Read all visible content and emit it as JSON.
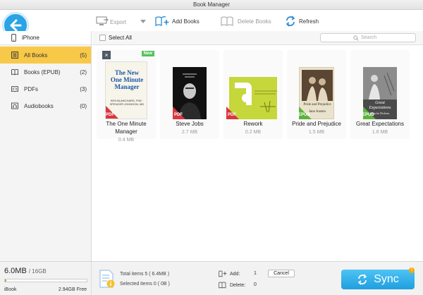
{
  "window": {
    "title": "Book Manager"
  },
  "toolbar": {
    "export_label": "Export",
    "add_label": "Add Books",
    "delete_label": "Delete Books",
    "refresh_label": "Refresh"
  },
  "sidebar": {
    "device": "iPhone",
    "items": [
      {
        "label": "All Books",
        "count": "(5)"
      },
      {
        "label": "Books (EPUB)",
        "count": "(2)"
      },
      {
        "label": "PDFs",
        "count": "(3)"
      },
      {
        "label": "Audiobooks",
        "count": "(0)"
      }
    ]
  },
  "content": {
    "select_all": "Select All",
    "search_placeholder": "Search"
  },
  "books": [
    {
      "title": "The One Minute Manager",
      "size": "0.4 MB",
      "format": "PDF",
      "tag": "New",
      "cover_text": "The New One Minute Manager",
      "cover_author": "KEN BLANCHARD, PhD · SPENCER JOHNSON, MD"
    },
    {
      "title": "Steve Jobs",
      "size": "2.7 MB",
      "format": "PDF"
    },
    {
      "title": "Rework",
      "size": "0.2 MB",
      "format": "PDF"
    },
    {
      "title": "Pride and Prejudice",
      "size": "1.5 MB",
      "format": "EPUB",
      "cover_text": "Pride and Prejudice",
      "cover_author": "Jane Austen"
    },
    {
      "title": "Great Expectations",
      "size": "1.6 MB",
      "format": "EPUB",
      "cover_text": "Great Expectations",
      "cover_author": "Charles Dickens"
    }
  ],
  "bottom": {
    "storage_used": "6.0MB",
    "storage_total": "/ 16GB",
    "storage_fraction": 0.02,
    "storage_left_label": "iBook",
    "storage_free": "2.94GB Free",
    "total_items": "Total items 5 ( 6.4MB )",
    "selected_items": "Selected items 0 ( 0B )",
    "add_label": "Add:",
    "add_value": "1",
    "delete_label": "Delete:",
    "delete_value": "0",
    "cancel_label": "Cancel",
    "sync_label": "Sync",
    "sync_badge": "!"
  },
  "colors": {
    "accent": "#2ba3e6",
    "active_item": "#f8c848",
    "pdf_badge": "#d9363e",
    "epub_badge": "#5bb43a",
    "new_tag": "#56c25a"
  }
}
